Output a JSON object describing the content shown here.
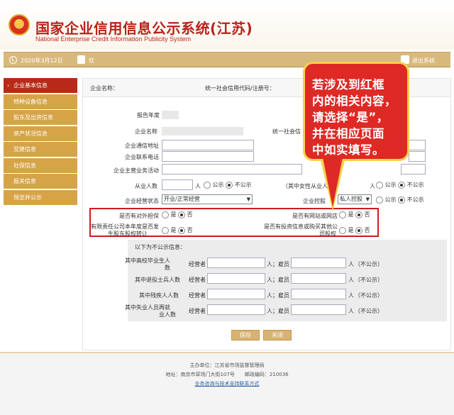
{
  "header": {
    "title": "国家企业信用信息公示系统",
    "province": "(江苏)",
    "subtitle": "National Enterprise Credit Information Publicity System"
  },
  "topbar": {
    "date": "2020年3月12日",
    "user_prefix": "欢",
    "logout": "退出系统"
  },
  "sidebar": {
    "items": [
      {
        "label": "企业基本信息",
        "active": true
      },
      {
        "label": "特种设备信息"
      },
      {
        "label": "股东及出资信息"
      },
      {
        "label": "资产状况信息"
      },
      {
        "label": "党建信息"
      },
      {
        "label": "社保信息"
      },
      {
        "label": "报关信息"
      },
      {
        "label": "预览并公示"
      }
    ]
  },
  "main": {
    "company_name_label": "企业名称：",
    "credit_code_label": "统一社会信用代码/注册号：",
    "report_year_label": "报告年度",
    "name_label": "企业名称",
    "credit_code_label2": "统一社会信",
    "address_label": "企业通信地址",
    "phone_label": "企业联系电话",
    "main_business_label": "企业主营业务活动",
    "employees_label": "从业人数",
    "employees_unit": "人",
    "female_label": "（其中女性从业人",
    "female_unit": "人",
    "status_label": "企业经营状态",
    "status_value": "开业/正常经营",
    "holding_label": "企业控股",
    "holding_value": "私人控股",
    "public": "公示",
    "not_public": "不公示",
    "guarantee_label": "是否有对外担保",
    "website_label": "是否有网站或网店",
    "equity_transfer_label_1": "有限责任公司本年度是否发",
    "equity_transfer_label_2": "生股东股权转让",
    "invest_label_1": "是否有投资信息或购买其他公",
    "invest_label_2": "司股权",
    "yes": "是",
    "no": "否"
  },
  "nonpublic": {
    "heading": "以下为不公示信息：",
    "rows": [
      {
        "label_1": "其中高校毕业生人",
        "label_2": "数"
      },
      {
        "label_1": "其中退役士兵人数",
        "label_2": ""
      },
      {
        "label_1": "其中残疾人人数",
        "label_2": ""
      },
      {
        "label_1": "其中失业人员再就",
        "label_2": "业人数"
      }
    ],
    "manager": "经营者",
    "person_employee": "人；雇员",
    "person_unit": "人",
    "not_public_note": "（不公示）"
  },
  "buttons": {
    "save": "保存",
    "close": "关闭"
  },
  "footer": {
    "line1": "主办单位：江苏省市场监督管理局",
    "line2": "地址：南京市草场门大街107号　　邮政编码：210036",
    "line3": "业务咨询与技术支持联系方式"
  },
  "callout": {
    "lines": [
      "若涉及到红框",
      "内的相关内容，",
      "请选择“是”，",
      "并在相应页面",
      "中如实填写。"
    ]
  },
  "colors": {
    "brand_red": "#b7231c",
    "gold": "#d8b97d",
    "sidebar_gold": "#d6a347",
    "sidebar_active": "#b72a17",
    "highlight_red": "#d21a1a",
    "bubble_red": "#de2924",
    "bubble_border": "#f5d24a"
  }
}
